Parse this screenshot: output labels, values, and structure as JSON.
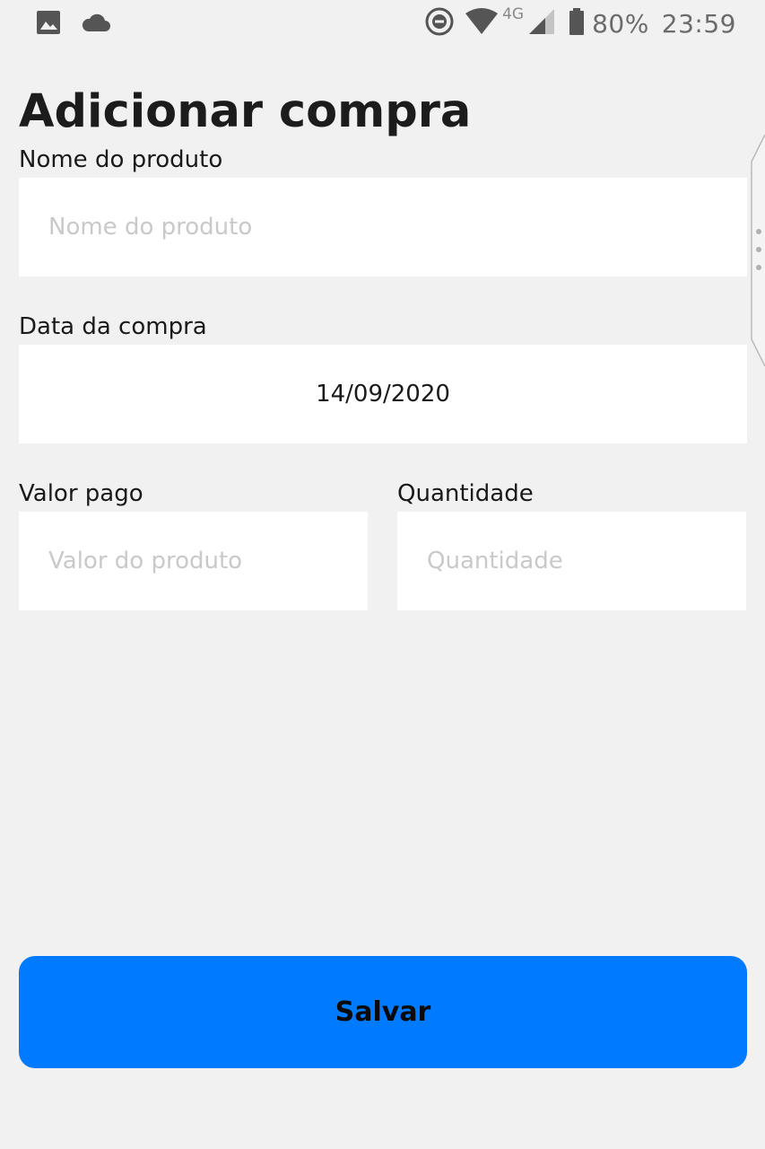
{
  "status_bar": {
    "left_icons": [
      "image-icon",
      "cloud-icon"
    ],
    "right_icons": [
      "do-not-disturb-icon",
      "wifi-icon",
      "cell-signal-icon",
      "battery-icon"
    ],
    "network": "4G",
    "battery": "80%",
    "time": "23:59"
  },
  "page": {
    "title": "Adicionar compra"
  },
  "form": {
    "product_name": {
      "label": "Nome do produto",
      "placeholder": "Nome do produto",
      "value": ""
    },
    "purchase_date": {
      "label": "Data da compra",
      "value": "14/09/2020"
    },
    "amount_paid": {
      "label": "Valor pago",
      "placeholder": "Valor do produto",
      "value": ""
    },
    "quantity": {
      "label": "Quantidade",
      "placeholder": "Quantidade",
      "value": ""
    },
    "save_label": "Salvar"
  },
  "colors": {
    "background": "#f1f1f1",
    "input_background": "#ffffff",
    "accent": "#007bff"
  }
}
